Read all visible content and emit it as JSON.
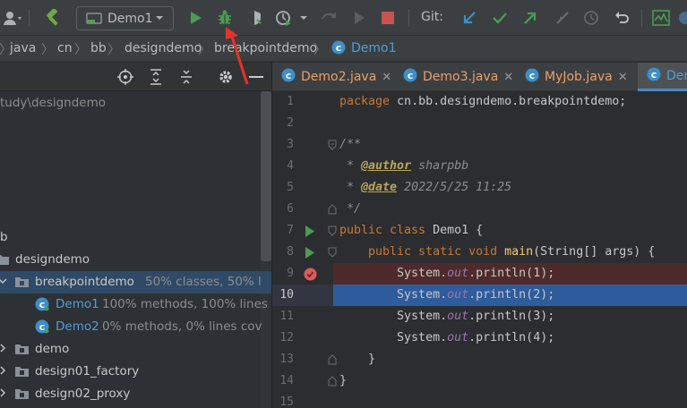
{
  "toolbar": {
    "run_config": "Demo1",
    "git_label": "Git:"
  },
  "breadcrumb": [
    "java",
    "cn",
    "bb",
    "designdemo",
    "breakpointdemo",
    "Demo1"
  ],
  "project": {
    "path_fragment": "tudy\\designdemo",
    "rows": [
      {
        "text": "b"
      },
      {
        "text": "designdemo"
      },
      {
        "text": "breakpointdemo",
        "coverage": "50% classes, 50% l"
      },
      {
        "text": "Demo1",
        "coverage": "100% methods, 100% lines"
      },
      {
        "text": "Demo2",
        "coverage": "0% methods, 0% lines cov"
      },
      {
        "text": "demo"
      },
      {
        "text": "design01_factory"
      },
      {
        "text": "design02_proxy"
      }
    ]
  },
  "tabs": [
    {
      "label": "Demo2.java"
    },
    {
      "label": "Demo3.java"
    },
    {
      "label": "MyJob.java"
    },
    {
      "label": "Dem"
    }
  ],
  "editor": {
    "line_numbers": [
      "1",
      "2",
      "3",
      "4",
      "5",
      "6",
      "7",
      "8",
      "9",
      "10",
      "11",
      "12",
      "13",
      "14",
      "15"
    ],
    "current_line": "10",
    "code": {
      "l1_kw": "package",
      "l1_rest": " cn.bb.designdemo.breakpointdemo;",
      "l3": "/**",
      "l4_pre": " * ",
      "l4_tag": "@author",
      "l4_val": " sharpbb",
      "l5_pre": " * ",
      "l5_tag": "@date",
      "l5_val": " 2022/5/25 11:25",
      "l6": " */",
      "l7_kw": "public class",
      "l7_rest": " Demo1 {",
      "l8_kw": "    public static void",
      "l8_fn": " main",
      "l8_rest": "(String[] args) {",
      "sys": "        System.",
      "out": "out",
      "println": ".println(",
      "l9_arg": "1",
      "l10_arg": "2",
      "l11_arg": "3",
      "l12_arg": "4",
      "end": ");",
      "l13": "    }",
      "l14": "}"
    }
  },
  "colors": {
    "accent": "#4a88c7",
    "run_green": "#499c54",
    "stop_red": "#c75450",
    "git_blue": "#3592c4",
    "breakpoint_red": "#db5c5c"
  }
}
